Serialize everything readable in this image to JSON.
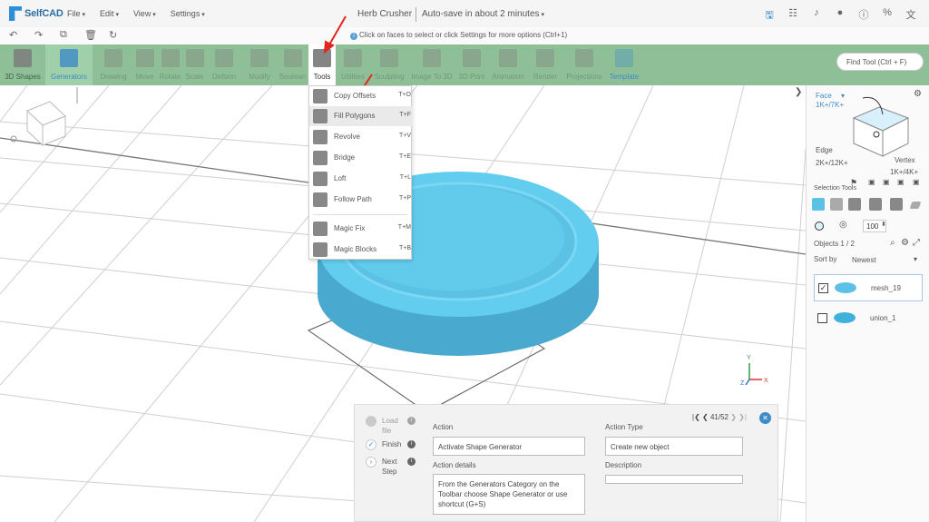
{
  "app": {
    "logo": "SelfCAD",
    "menus": [
      "File",
      "Edit",
      "View",
      "Settings"
    ],
    "project_title": "Herb Crusher",
    "autosave": "Auto-save in about 2 minutes"
  },
  "hint": "Click on faces to select or click Settings for more options (Ctrl+1)",
  "toolbar": {
    "items": [
      "3D Shapes",
      "Generators",
      "Drawing",
      "Move",
      "Rotate",
      "Scale",
      "Deform",
      "Modify",
      "Boolean",
      "Tools",
      "Utilities",
      "Sculpting",
      "Image To 3D",
      "3D Print",
      "Animation",
      "Render",
      "Projections",
      "Template"
    ],
    "find_tool": "Find Tool (Ctrl + F)"
  },
  "tools_menu": [
    {
      "label": "Copy Offsets",
      "key": "T+O"
    },
    {
      "label": "Fill Polygons",
      "key": "T+F"
    },
    {
      "label": "Revolve",
      "key": "T+V"
    },
    {
      "label": "Bridge",
      "key": "T+E"
    },
    {
      "label": "Loft",
      "key": "T+L"
    },
    {
      "label": "Follow Path",
      "key": "T+P"
    },
    {
      "label": "Magic Fix",
      "key": "T+M"
    },
    {
      "label": "Magic Blocks",
      "key": "T+B"
    }
  ],
  "right_panel": {
    "face_label": "Face",
    "face_count": "1K+/7K+",
    "edge_label": "Edge",
    "edge_count": "2K+/12K+",
    "vertex_label": "Vertex",
    "vertex_count": "1K+/4K+",
    "selection_tools": "Selection Tools",
    "brush_size": "100",
    "objects": "Objects 1 / 2",
    "sort_label": "Sort by",
    "sort_value": "Newest",
    "object_list": [
      {
        "name": "mesh_19",
        "checked": true
      },
      {
        "name": "union_1",
        "checked": false
      }
    ]
  },
  "tutorial": {
    "steps": [
      "Load file",
      "Finish",
      "Next Step"
    ],
    "pager": "41/52",
    "action_label": "Action",
    "action_value": "Activate Shape Generator",
    "action_details_label": "Action details",
    "action_details_value": "From the Generators Category on the Toolbar choose Shape Generator or use shortcut (G+S)",
    "action_type_label": "Action Type",
    "action_type_value": "Create new object",
    "description_label": "Description"
  },
  "colors": {
    "toolbar_bg": "#8fbf97",
    "model": "#5bc2e6",
    "accent": "#3e8bc7",
    "arrow": "#e0261f"
  },
  "axis_labels": {
    "x": "X",
    "y": "Y",
    "z": "Z"
  }
}
